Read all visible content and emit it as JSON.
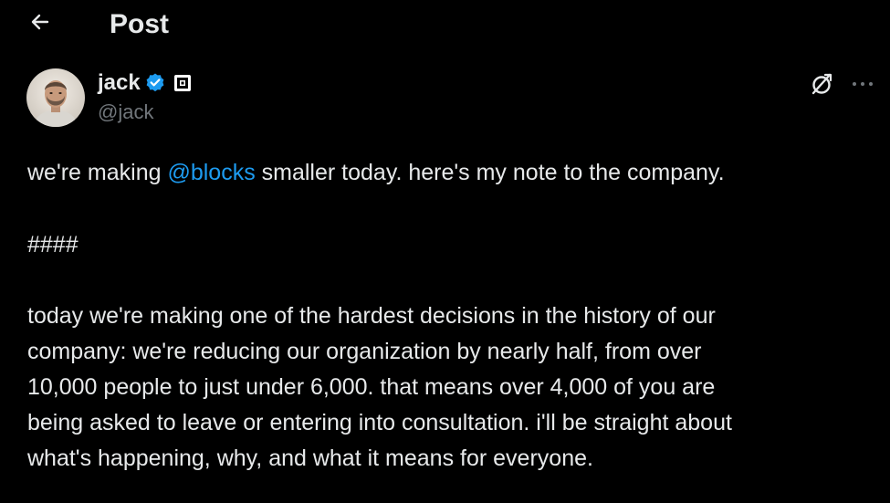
{
  "header": {
    "title": "Post",
    "back_icon": "arrow-left-icon"
  },
  "author": {
    "display_name": "jack",
    "handle": "@jack",
    "verified_icon": "verified-badge-icon",
    "verified_color": "#1d9bf0",
    "affiliate_icon": "affiliate-square-icon"
  },
  "actions": {
    "grok_icon": "grok-icon",
    "more_icon": "more-dots-icon"
  },
  "post": {
    "line1_prefix": "we're making ",
    "mention": "@blocks",
    "line1_suffix": " smaller today. here's my note to the company.",
    "separator": "####",
    "paragraph_lines": [
      "today we're making one of the hardest decisions in the history of our",
      "company: we're reducing our organization by nearly half, from over",
      "10,000 people to just under 6,000. that means over 4,000 of you are",
      "being asked to leave or entering into consultation. i'll be straight about",
      "what's happening, why, and what it means for everyone."
    ]
  },
  "colors": {
    "background": "#000000",
    "text": "#e7e9ea",
    "secondary_text": "#71767b",
    "link": "#1d9bf0"
  }
}
